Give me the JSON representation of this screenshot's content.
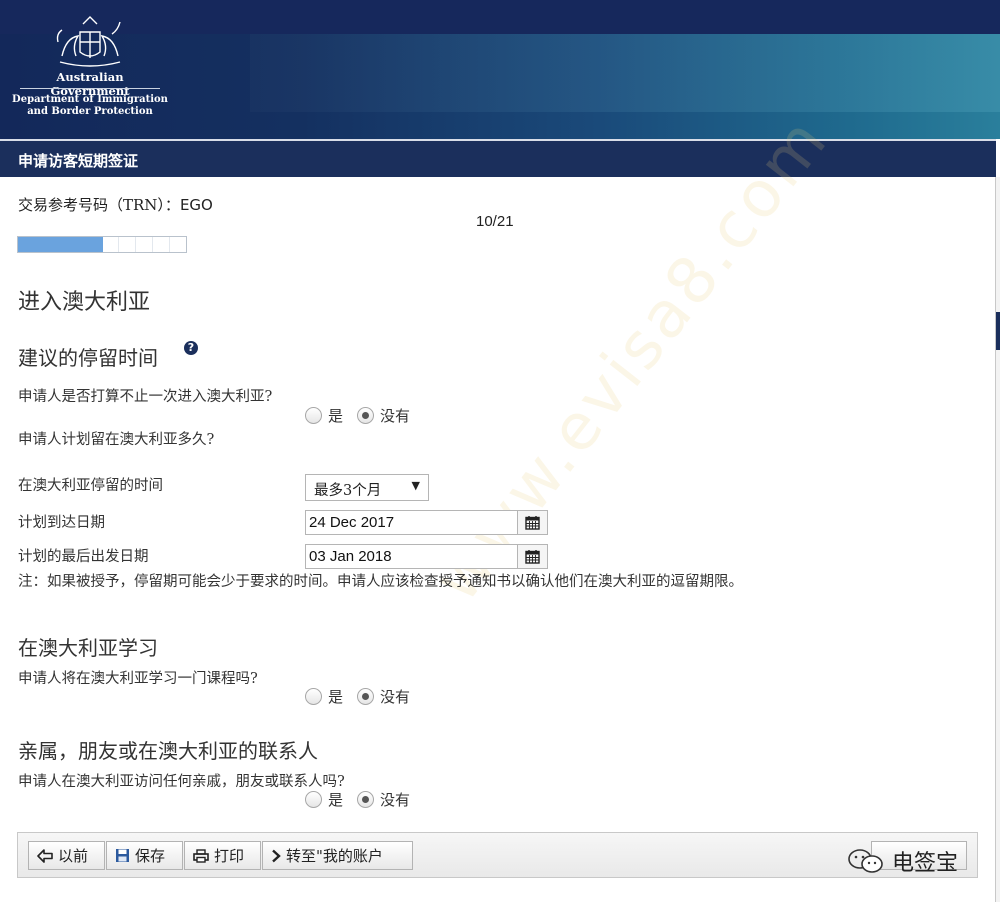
{
  "header": {
    "gov_name": "Australian Government",
    "department_line1": "Department of Immigration",
    "department_line2": "and Border Protection"
  },
  "titlebar": {
    "title": "申请访客短期签证"
  },
  "trn": {
    "label": "交易参考号码（TRN）：",
    "value": "EGO"
  },
  "progress": {
    "step_text": "10/21",
    "current": 10,
    "total": 21
  },
  "page_title": "进入澳大利亚",
  "sections": {
    "stay": {
      "heading": "建议的停留时间",
      "q_multiple_entry": "申请人是否打算不止一次进入澳大利亚?",
      "q_multiple_entry_selected": "没有",
      "q_how_long": "申请人计划留在澳大利亚多久?",
      "length_label": "在澳大利亚停留的时间",
      "length_value": "最多3个月",
      "arrival_label": "计划到达日期",
      "arrival_value": "24 Dec 2017",
      "departure_label": "计划的最后出发日期",
      "departure_value": "03 Jan 2018",
      "note": "注：如果被授予，停留期可能会少于要求的时间。申请人应该检查授予通知书以确认他们在澳大利亚的逗留期限。"
    },
    "study": {
      "heading": "在澳大利亚学习",
      "question": "申请人将在澳大利亚学习一门课程吗?",
      "selected": "没有"
    },
    "contacts": {
      "heading": "亲属，朋友或在澳大利亚的联系人",
      "question": "申请人在澳大利亚访问任何亲戚，朋友或联系人吗?",
      "selected": "没有"
    }
  },
  "radio_labels": {
    "yes": "是",
    "no": "没有"
  },
  "toolbar": {
    "previous": "以前",
    "save": "保存",
    "print": "打印",
    "account": "转至\"我的账户"
  },
  "wechat_label": "电签宝",
  "watermark": "www.evisa8.com",
  "colors": {
    "banner": "#13285a",
    "titlebar": "#1b2f5c",
    "progress_fill": "#6aa3de"
  }
}
